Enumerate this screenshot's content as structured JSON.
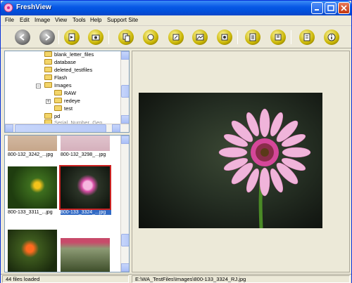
{
  "window": {
    "title": "FreshView"
  },
  "menu": [
    "File",
    "Edit",
    "Image",
    "View",
    "Tools",
    "Help",
    "Support Site"
  ],
  "toolbar": {
    "buttons": [
      {
        "icon": "back-icon"
      },
      {
        "icon": "forward-icon"
      },
      {
        "icon": "slideshow-icon"
      },
      {
        "icon": "camera-icon"
      },
      {
        "icon": "copy-icon"
      },
      {
        "icon": "move-icon"
      },
      {
        "icon": "rename-icon"
      },
      {
        "icon": "photo-icon"
      },
      {
        "icon": "audio-icon"
      },
      {
        "icon": "print-icon"
      },
      {
        "icon": "export-icon"
      },
      {
        "icon": "properties-icon"
      },
      {
        "icon": "info-icon"
      }
    ]
  },
  "tree": {
    "items": [
      {
        "label": "blank_letter_files"
      },
      {
        "label": "database"
      },
      {
        "label": "deleted_testfiles"
      },
      {
        "label": "Flash"
      },
      {
        "label": "Images",
        "expander": "−"
      },
      {
        "label": "RAW"
      },
      {
        "label": "redeye",
        "expander": "+"
      },
      {
        "label": "test"
      },
      {
        "label": "pd"
      },
      {
        "label": "Serial_Number_Gen"
      }
    ]
  },
  "thumbnails": [
    {
      "caption": "800-132_3242_...jpg"
    },
    {
      "caption": "800-132_3298_...jpg"
    },
    {
      "caption": "800-133_3311_...jpg"
    },
    {
      "caption": "800-133_3324_...jpg"
    },
    {
      "caption": ""
    },
    {
      "caption": ""
    }
  ],
  "status": {
    "count": "44 files loaded",
    "path": "E:\\WA_TestFiles\\Images\\800-133_3324_RJ.jpg"
  },
  "colors": {
    "titlebar": "#0a5ae6",
    "selection": "#316ac5",
    "selected_border": "#cc2222"
  }
}
